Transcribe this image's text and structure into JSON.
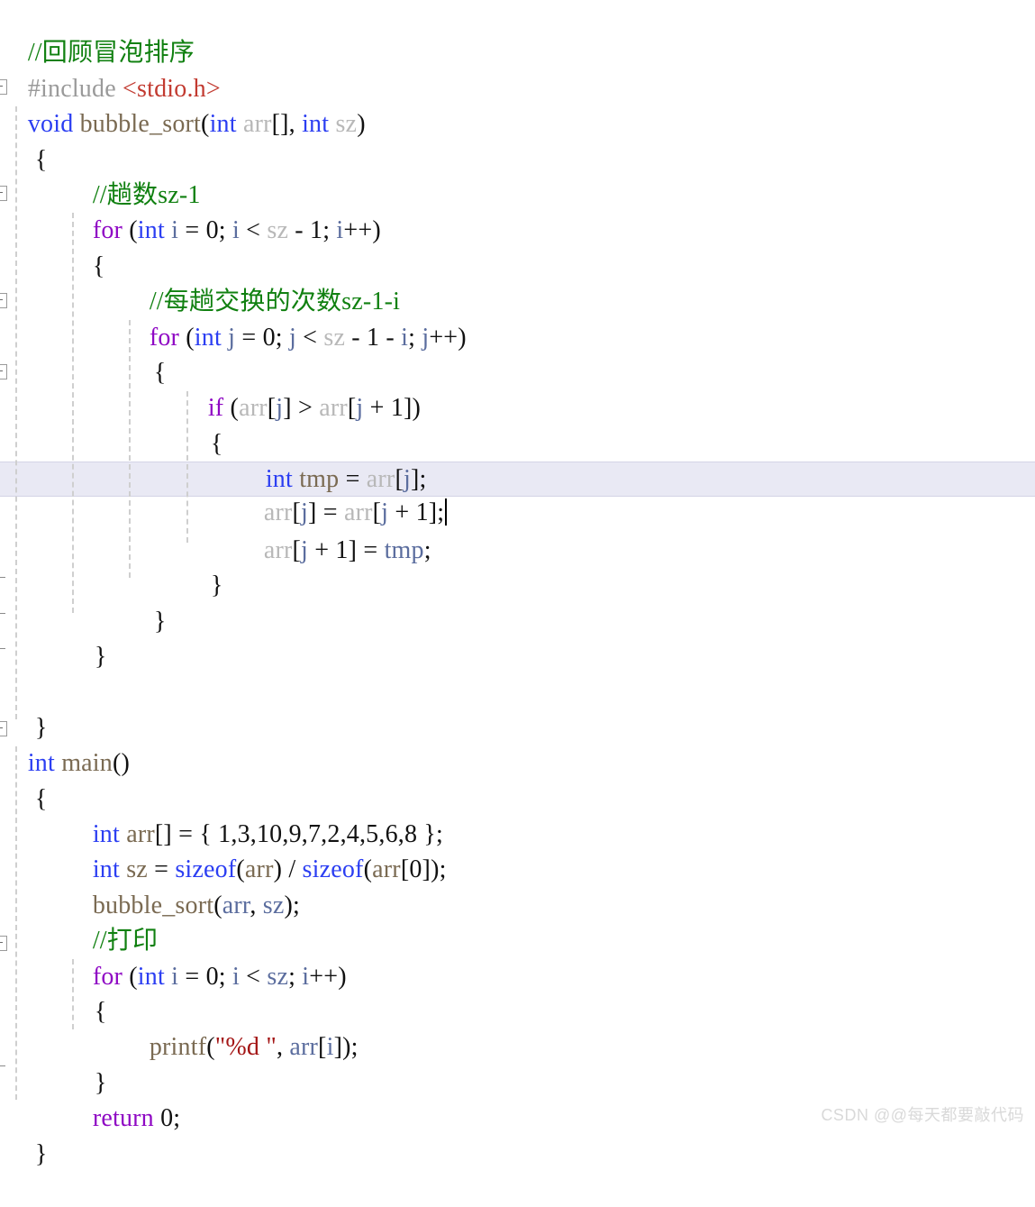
{
  "editor": {
    "language": "C",
    "theme": "light",
    "font_size_px": 28,
    "line_height_px": 39.4,
    "current_line_number": 14,
    "colors": {
      "background": "#ffffff",
      "keyword": "#8f08c4",
      "type": "#2b3ef2",
      "comment": "#108010",
      "preprocessor": "#9a9a9a",
      "include_path": "#c23a30",
      "string": "#a31515",
      "function": "#7a6a52",
      "variable": "#5b6d9e",
      "parameter": "#b8b8b8",
      "number": "#111111",
      "current_line_highlight": "#e9e9f4",
      "indent_guide": "#cfcfcf"
    }
  },
  "code_lines": [
    {
      "n": 1,
      "indent": 0,
      "text": "//回顾冒泡排序"
    },
    {
      "n": 2,
      "indent": 0,
      "text": "#include <stdio.h>"
    },
    {
      "n": 3,
      "indent": 0,
      "text": "void bubble_sort(int arr[], int sz)"
    },
    {
      "n": 4,
      "indent": 0,
      "text": "{"
    },
    {
      "n": 5,
      "indent": 1,
      "text": "//趟数sz-1"
    },
    {
      "n": 6,
      "indent": 1,
      "text": "for (int i = 0; i < sz - 1; i++)"
    },
    {
      "n": 7,
      "indent": 1,
      "text": "{"
    },
    {
      "n": 8,
      "indent": 2,
      "text": "//每趟交换的次数sz-1-i"
    },
    {
      "n": 9,
      "indent": 2,
      "text": "for (int j = 0; j < sz - 1 - i; j++)"
    },
    {
      "n": 10,
      "indent": 2,
      "text": "{"
    },
    {
      "n": 11,
      "indent": 3,
      "text": "if (arr[j] > arr[j + 1])"
    },
    {
      "n": 12,
      "indent": 3,
      "text": "{"
    },
    {
      "n": 13,
      "indent": 4,
      "text": "int tmp = arr[j];"
    },
    {
      "n": 14,
      "indent": 4,
      "text": "arr[j] = arr[j + 1];"
    },
    {
      "n": 15,
      "indent": 4,
      "text": "arr[j + 1] = tmp;"
    },
    {
      "n": 16,
      "indent": 3,
      "text": "}"
    },
    {
      "n": 17,
      "indent": 2,
      "text": "}"
    },
    {
      "n": 18,
      "indent": 1,
      "text": "}"
    },
    {
      "n": 19,
      "indent": 0,
      "text": ""
    },
    {
      "n": 20,
      "indent": 0,
      "text": "}"
    },
    {
      "n": 21,
      "indent": 0,
      "text": "int main()"
    },
    {
      "n": 22,
      "indent": 0,
      "text": "{"
    },
    {
      "n": 23,
      "indent": 1,
      "text": "int arr[] = { 1,3,10,9,7,2,4,5,6,8 };"
    },
    {
      "n": 24,
      "indent": 1,
      "text": "int sz = sizeof(arr) / sizeof(arr[0]);"
    },
    {
      "n": 25,
      "indent": 1,
      "text": "bubble_sort(arr, sz);"
    },
    {
      "n": 26,
      "indent": 1,
      "text": "//打印"
    },
    {
      "n": 27,
      "indent": 1,
      "text": "for (int i = 0; i < sz; i++)"
    },
    {
      "n": 28,
      "indent": 1,
      "text": "{"
    },
    {
      "n": 29,
      "indent": 2,
      "text": "printf(\"%d \", arr[i]);"
    },
    {
      "n": 30,
      "indent": 1,
      "text": "}"
    },
    {
      "n": 31,
      "indent": 1,
      "text": "return 0;"
    },
    {
      "n": 32,
      "indent": 0,
      "text": "}"
    }
  ],
  "tokens": {
    "comment_review_bubble_sort": "//回顾冒泡排序",
    "pp_include": "#include",
    "include_header": "<stdio.h>",
    "kw_void": "void",
    "fn_bubble_sort": "bubble_sort",
    "kw_int": "int",
    "param_arr": "arr",
    "param_sz": "sz",
    "comment_passes": "//趟数sz-1",
    "kw_for": "for",
    "var_i": "i",
    "var_j": "j",
    "num_zero": "0",
    "num_one": "1",
    "comment_swaps": "//每趟交换的次数sz-1-i",
    "kw_if": "if",
    "var_tmp": "tmp",
    "fn_main": "main",
    "kw_sizeof": "sizeof",
    "array_init": "{ 1,3,10,9,7,2,4,5,6,8 }",
    "comment_print": "//打印",
    "fn_printf": "printf",
    "str_format": "\"%d \"",
    "kw_return": "return"
  },
  "array_values": [
    1,
    3,
    10,
    9,
    7,
    2,
    4,
    5,
    6,
    8
  ],
  "watermark": {
    "text": "CSDN @@每天都要敲代码"
  }
}
